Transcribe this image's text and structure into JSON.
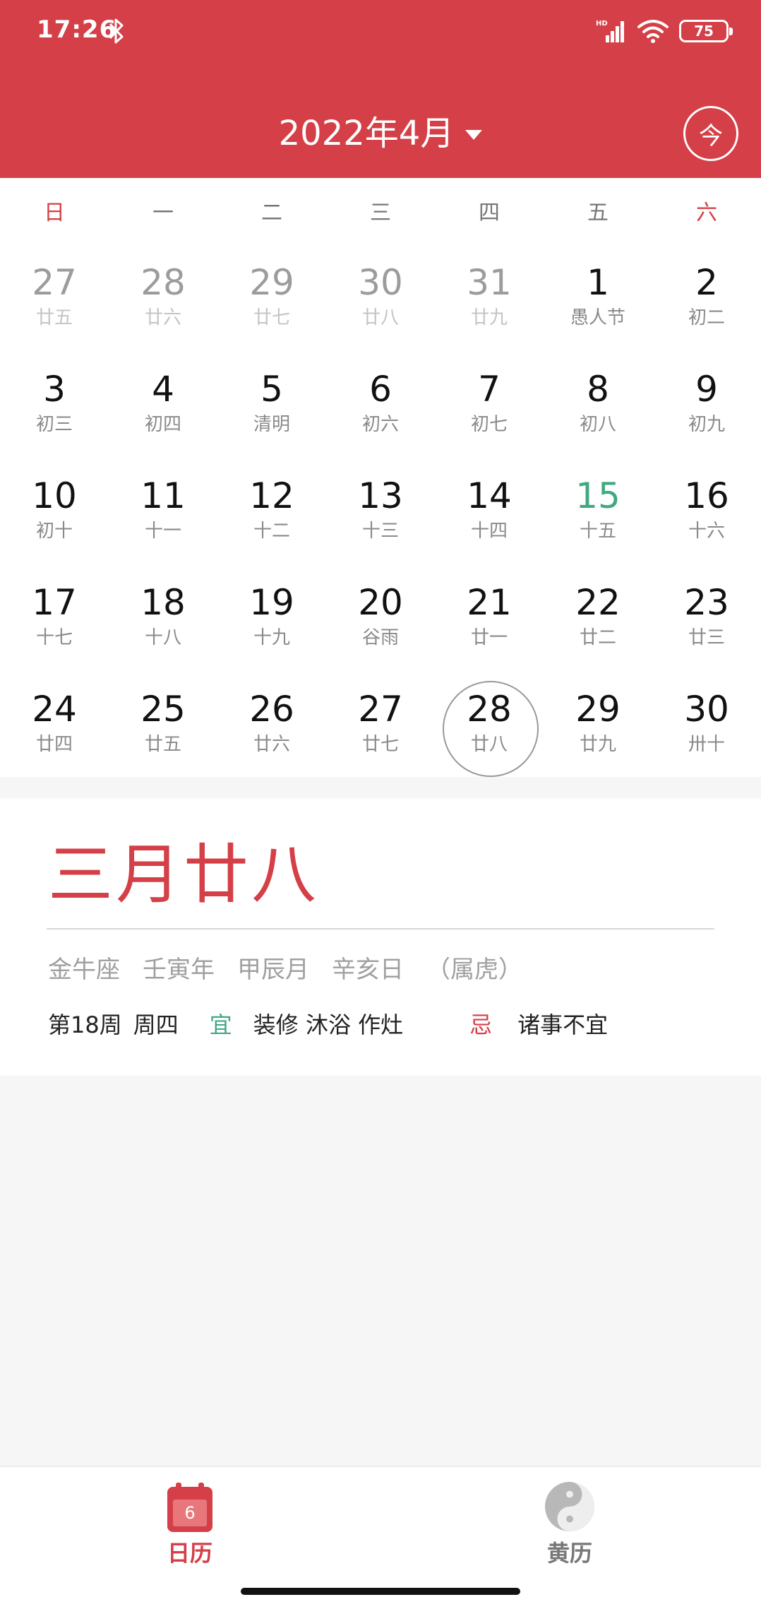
{
  "status_bar": {
    "time": "17:26",
    "battery": "75",
    "signal_tag": "HD"
  },
  "header": {
    "month_title": "2022年4月",
    "today_button": "今"
  },
  "weekdays": [
    "日",
    "一",
    "二",
    "三",
    "四",
    "五",
    "六"
  ],
  "weeks": [
    [
      {
        "day": "27",
        "sub": "廿五",
        "other": true
      },
      {
        "day": "28",
        "sub": "廿六",
        "other": true
      },
      {
        "day": "29",
        "sub": "廿七",
        "other": true
      },
      {
        "day": "30",
        "sub": "廿八",
        "other": true
      },
      {
        "day": "31",
        "sub": "廿九",
        "other": true
      },
      {
        "day": "1",
        "sub": "愚人节"
      },
      {
        "day": "2",
        "sub": "初二"
      }
    ],
    [
      {
        "day": "3",
        "sub": "初三"
      },
      {
        "day": "4",
        "sub": "初四"
      },
      {
        "day": "5",
        "sub": "清明"
      },
      {
        "day": "6",
        "sub": "初六"
      },
      {
        "day": "7",
        "sub": "初七"
      },
      {
        "day": "8",
        "sub": "初八"
      },
      {
        "day": "9",
        "sub": "初九"
      }
    ],
    [
      {
        "day": "10",
        "sub": "初十"
      },
      {
        "day": "11",
        "sub": "十一"
      },
      {
        "day": "12",
        "sub": "十二"
      },
      {
        "day": "13",
        "sub": "十三"
      },
      {
        "day": "14",
        "sub": "十四"
      },
      {
        "day": "15",
        "sub": "十五",
        "holiday": true
      },
      {
        "day": "16",
        "sub": "十六"
      }
    ],
    [
      {
        "day": "17",
        "sub": "十七"
      },
      {
        "day": "18",
        "sub": "十八"
      },
      {
        "day": "19",
        "sub": "十九"
      },
      {
        "day": "20",
        "sub": "谷雨"
      },
      {
        "day": "21",
        "sub": "廿一"
      },
      {
        "day": "22",
        "sub": "廿二"
      },
      {
        "day": "23",
        "sub": "廿三"
      }
    ],
    [
      {
        "day": "24",
        "sub": "廿四"
      },
      {
        "day": "25",
        "sub": "廿五"
      },
      {
        "day": "26",
        "sub": "廿六"
      },
      {
        "day": "27",
        "sub": "廿七"
      },
      {
        "day": "28",
        "sub": "廿八",
        "selected": true
      },
      {
        "day": "29",
        "sub": "廿九"
      },
      {
        "day": "30",
        "sub": "卅十"
      }
    ]
  ],
  "detail": {
    "lunar_date": "三月廿八",
    "zodiac_sign": "金牛座",
    "year_ganzhi": "壬寅年",
    "month_ganzhi": "甲辰月",
    "day_ganzhi": "辛亥日",
    "animal": "（属虎）",
    "week_number": "第18周",
    "weekday": "周四",
    "yi_label": "宜",
    "yi_items": "装修 沐浴 作灶",
    "ji_label": "忌",
    "ji_items": "诸事不宜"
  },
  "bottom_nav": {
    "calendar_label": "日历",
    "calendar_icon_day": "6",
    "huangli_label": "黄历"
  },
  "colors": {
    "primary": "#d53f47",
    "holiday": "#3fa980",
    "yi": "#3fa980"
  }
}
